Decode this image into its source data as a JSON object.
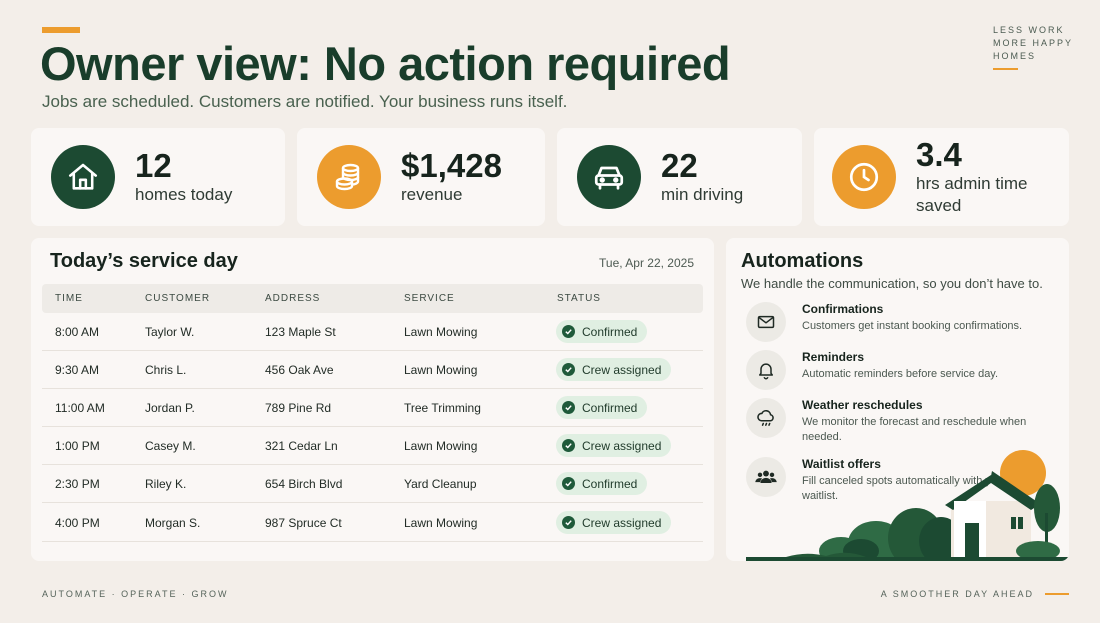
{
  "header": {
    "title": "Owner view: No action required",
    "subtitle": "Jobs are scheduled. Customers are notified. Your business runs itself.",
    "tagline": [
      "LESS WORK",
      "MORE HAPPY",
      "HOMES"
    ]
  },
  "stats": [
    {
      "value": "12",
      "label": "homes today",
      "icon": "house-icon"
    },
    {
      "value": "$1,428",
      "label": "revenue",
      "icon": "coins-icon"
    },
    {
      "value": "22",
      "label": "min driving",
      "icon": "car-icon"
    },
    {
      "value": "3.4",
      "label": "hrs admin time saved",
      "icon": "clock-icon"
    }
  ],
  "service_day": {
    "title": "Today’s service day",
    "date": "Tue, Apr 22, 2025",
    "columns": [
      "TIME",
      "CUSTOMER",
      "ADDRESS",
      "SERVICE",
      "STATUS"
    ],
    "rows": [
      {
        "time": "8:00 AM",
        "customer": "Taylor W.",
        "address": "123 Maple St",
        "service": "Lawn Mowing",
        "status": "Confirmed"
      },
      {
        "time": "9:30 AM",
        "customer": "Chris L.",
        "address": "456 Oak Ave",
        "service": "Lawn Mowing",
        "status": "Crew assigned"
      },
      {
        "time": "11:00 AM",
        "customer": "Jordan P.",
        "address": "789 Pine Rd",
        "service": "Tree Trimming",
        "status": "Confirmed"
      },
      {
        "time": "1:00 PM",
        "customer": "Casey M.",
        "address": "321 Cedar Ln",
        "service": "Lawn Mowing",
        "status": "Crew assigned"
      },
      {
        "time": "2:30 PM",
        "customer": "Riley K.",
        "address": "654 Birch Blvd",
        "service": "Yard Cleanup",
        "status": "Confirmed"
      },
      {
        "time": "4:00 PM",
        "customer": "Morgan S.",
        "address": "987 Spruce Ct",
        "service": "Lawn Mowing",
        "status": "Crew assigned"
      }
    ]
  },
  "automations": {
    "title": "Automations",
    "subtitle": "We handle the communication, so you don’t have to.",
    "items": [
      {
        "name": "Confirmations",
        "desc": "Customers get instant booking confirmations.",
        "icon": "mail-icon"
      },
      {
        "name": "Reminders",
        "desc": "Automatic reminders before service day.",
        "icon": "bell-icon"
      },
      {
        "name": "Weather reschedules",
        "desc": "We monitor the forecast and reschedule when needed.",
        "icon": "rain-cloud-icon"
      },
      {
        "name": "Waitlist offers",
        "desc": "Fill canceled spots automatically with your waitlist.",
        "icon": "people-icon"
      }
    ]
  },
  "footer": {
    "left": "AUTOMATE · OPERATE · GROW",
    "right": "A SMOOTHER DAY AHEAD"
  },
  "colors": {
    "brand_green": "#1c4a32",
    "accent_orange": "#ec9c2e",
    "background": "#f3eee9",
    "badge_bg": "#e0efe2"
  }
}
